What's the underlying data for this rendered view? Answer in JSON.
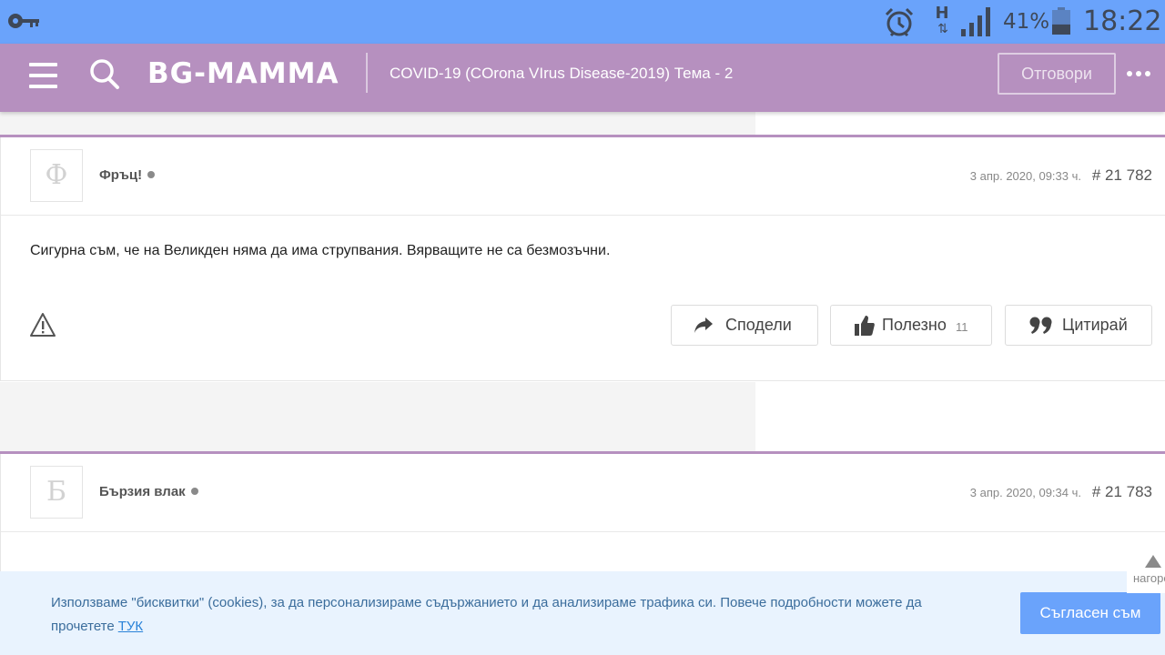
{
  "status_bar": {
    "network_type": "H",
    "network_arrows": "⇅",
    "battery_percent": "41%",
    "battery_level": 0.41,
    "time": "18:22",
    "icons": [
      "key-icon",
      "alarm-icon",
      "signal-icon",
      "battery-icon"
    ]
  },
  "header": {
    "logo": "BG-MAMMA",
    "topic_title": "COVID-19 (COrona VIrus Disease-2019) Тема - 2",
    "reply_label": "Отговори",
    "icons": [
      "menu-icon",
      "search-icon",
      "more-icon"
    ]
  },
  "posts": [
    {
      "avatar_letter": "Ф",
      "author": "Фръц!",
      "date": "3 апр. 2020, 09:33 ч.",
      "number": "# 21 782",
      "body": "Сигурна съм, че на Великден няма да има струпвания. Вярващите не са безмозъчни.",
      "actions": {
        "share_label": "Сподели",
        "useful_label": "Полезно",
        "useful_count": "11",
        "quote_label": "Цитирай"
      }
    },
    {
      "avatar_letter": "Б",
      "author": "Бързия влак",
      "date": "3 апр. 2020, 09:34 ч.",
      "number": "# 21 783"
    }
  ],
  "scroll_top_label": "нагоре",
  "cookie": {
    "text": "Използваме \"бисквитки\" (cookies), за да персонализираме съдържанието и да анализираме трафика си. Повече подробности можете да прочетете",
    "link": "ТУК",
    "accept_label": "Съгласен съм"
  },
  "colors": {
    "status_bar": "#6aa3fb",
    "header": "#b690bf",
    "cookie_bg": "#e9f3fe",
    "cookie_button": "#6aa3fb"
  }
}
